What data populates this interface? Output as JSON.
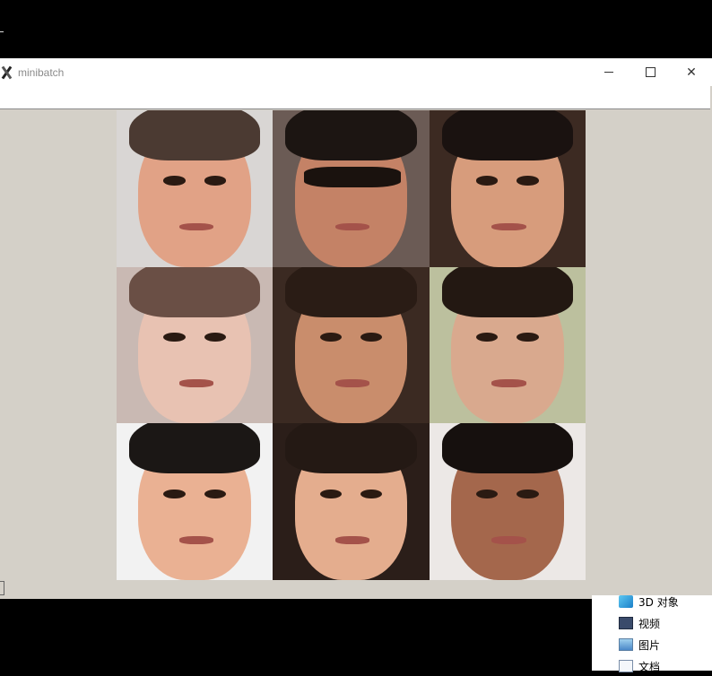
{
  "window": {
    "title": "minibatch",
    "minimize_label": "",
    "maximize_label": "",
    "close_label": "✕"
  },
  "grid": {
    "faces": [
      {
        "bg": "#d9d6d4",
        "skin": "#e1a286",
        "hair": "#4b3a32",
        "glasses": false
      },
      {
        "bg": "#6b5b55",
        "skin": "#c48266",
        "hair": "#1c1512",
        "glasses": true
      },
      {
        "bg": "#3c2a22",
        "skin": "#d79c7c",
        "hair": "#1a1210",
        "glasses": false
      },
      {
        "bg": "#c9b9b3",
        "skin": "#e8c2b2",
        "hair": "#6a4f45",
        "glasses": false
      },
      {
        "bg": "#3b2a22",
        "skin": "#c98d6c",
        "hair": "#2a1c15",
        "glasses": false
      },
      {
        "bg": "#bcc09e",
        "skin": "#d9a98e",
        "hair": "#231812",
        "glasses": false
      },
      {
        "bg": "#f2f2f2",
        "skin": "#eab193",
        "hair": "#1b1715",
        "glasses": false
      },
      {
        "bg": "#2b1e19",
        "skin": "#e4ad8e",
        "hair": "#241914",
        "glasses": false
      },
      {
        "bg": "#ece8e6",
        "skin": "#a4674c",
        "hair": "#16100e",
        "glasses": false
      }
    ]
  },
  "explorer": {
    "items": [
      {
        "icon": "3d-objects-icon",
        "label": "3D 对象"
      },
      {
        "icon": "video-icon",
        "label": "视频"
      },
      {
        "icon": "picture-icon",
        "label": "图片"
      },
      {
        "icon": "document-icon",
        "label": "文档"
      }
    ]
  }
}
